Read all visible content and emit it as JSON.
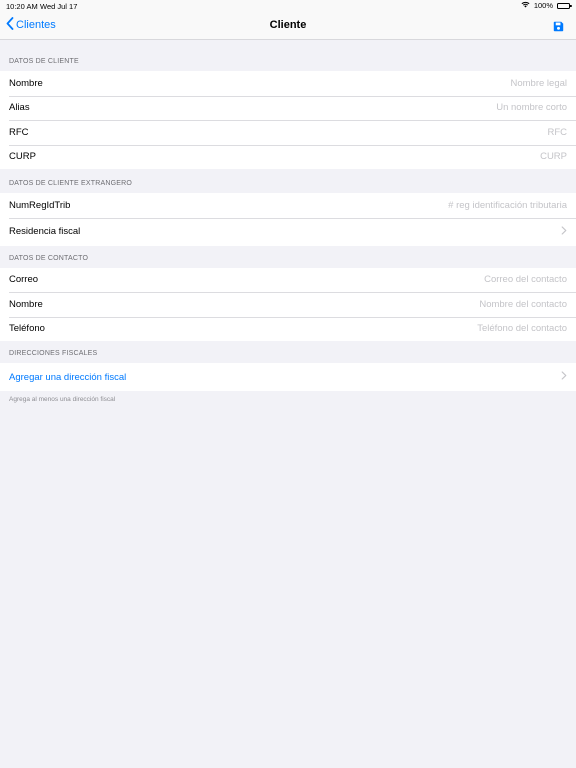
{
  "status_bar": {
    "time": "10:20 AM",
    "date": "Wed Jul 17",
    "battery": "100%",
    "battery_level": 1.0
  },
  "navbar": {
    "back_label": "Clientes",
    "title": "Cliente",
    "save_icon": "save-icon"
  },
  "sections": {
    "cliente": {
      "header": "DATOS DE CLIENTE",
      "rows": [
        {
          "label": "Nombre",
          "placeholder": "Nombre legal"
        },
        {
          "label": "Alias",
          "placeholder": "Un nombre corto"
        },
        {
          "label": "RFC",
          "placeholder": "RFC"
        },
        {
          "label": "CURP",
          "placeholder": "CURP"
        }
      ]
    },
    "extranjero": {
      "header": "DATOS DE CLIENTE EXTRANGERO",
      "rows": [
        {
          "label": "NumRegIdTrib",
          "placeholder": "# reg identificación tributaria"
        },
        {
          "label": "Residencia fiscal"
        }
      ]
    },
    "contacto": {
      "header": "DATOS DE CONTACTO",
      "rows": [
        {
          "label": "Correo",
          "placeholder": "Correo del contacto"
        },
        {
          "label": "Nombre",
          "placeholder": "Nombre del contacto"
        },
        {
          "label": "Teléfono",
          "placeholder": "Teléfono del contacto"
        }
      ]
    },
    "direcciones": {
      "header": "DIRECCIONES FISCALES",
      "add_label": "Agregar una dirección fiscal",
      "footer": "Agrega al menos una dirección fiscal"
    }
  },
  "colors": {
    "accent": "#007aff",
    "background": "#f2f2f7",
    "placeholder": "#c4c4c8",
    "section_header": "#6d6d72"
  }
}
